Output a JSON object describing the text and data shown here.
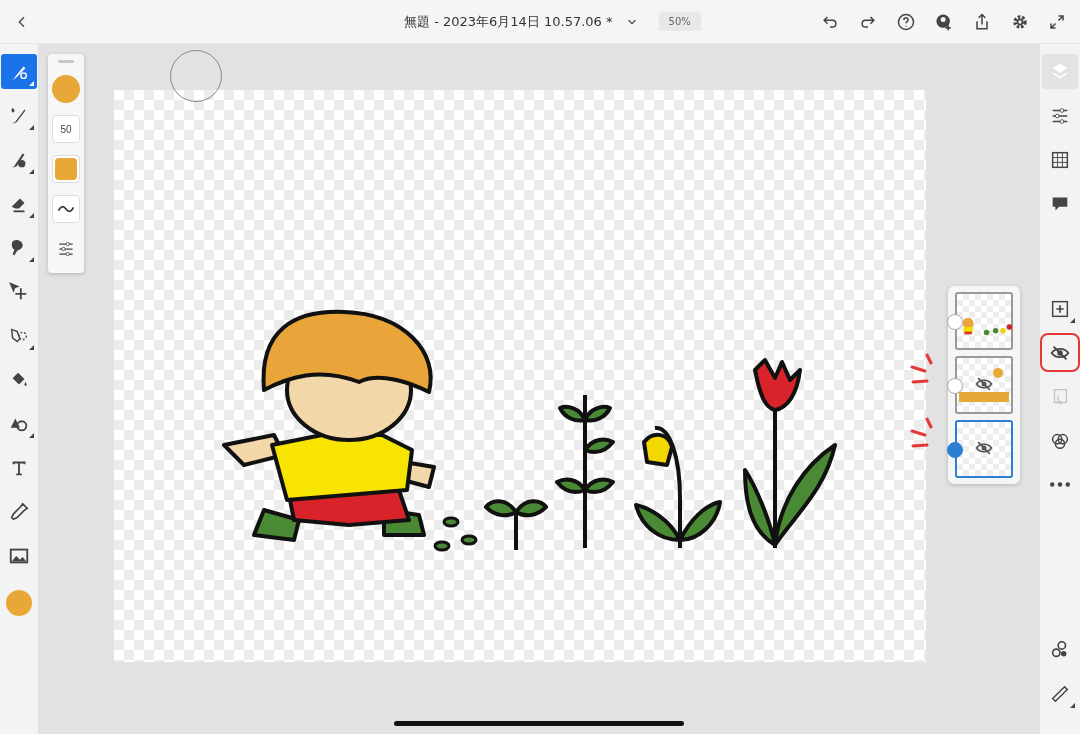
{
  "header": {
    "title": "無題 - 2023年6月14日 10.57.06 *",
    "zoom": "50%"
  },
  "left_tools": [
    {
      "selected": true,
      "submenu": true
    },
    {
      "selected": false,
      "submenu": true
    },
    {
      "selected": false,
      "submenu": true
    },
    {
      "selected": false,
      "submenu": true
    },
    {
      "selected": false,
      "submenu": true
    },
    {
      "selected": false,
      "submenu": false
    },
    {
      "selected": false,
      "submenu": true
    },
    {
      "selected": false,
      "submenu": false
    },
    {
      "selected": false,
      "submenu": true
    },
    {
      "selected": false,
      "submenu": false
    },
    {
      "selected": false,
      "submenu": false
    },
    {
      "selected": false,
      "submenu": false
    }
  ],
  "current_color": {
    "color": "#e8a838"
  },
  "brush_panel": {
    "color": "#e8a838",
    "size": "50"
  },
  "right_tools": [
    {
      "selected": true,
      "disabled": false,
      "highlighted": false,
      "submenu": false
    },
    {
      "selected": false,
      "disabled": false,
      "highlighted": false,
      "submenu": false
    },
    {
      "selected": false,
      "disabled": false,
      "highlighted": false,
      "submenu": false
    },
    {
      "selected": false,
      "disabled": false,
      "highlighted": false,
      "submenu": false
    },
    {
      "selected": false,
      "disabled": false,
      "highlighted": false,
      "submenu": true
    },
    {
      "selected": false,
      "disabled": false,
      "highlighted": true,
      "submenu": false
    },
    {
      "selected": false,
      "disabled": true,
      "highlighted": false,
      "submenu": false
    },
    {
      "selected": false,
      "disabled": false,
      "highlighted": false,
      "submenu": false
    },
    {
      "selected": false,
      "disabled": false,
      "highlighted": false,
      "submenu": false
    }
  ],
  "right_bottom_tools": [
    {
      "submenu": false
    },
    {
      "submenu": true
    }
  ],
  "layers": [
    {
      "kind": "artwork",
      "hidden": false,
      "selected": false,
      "annotated": false
    },
    {
      "kind": "sun",
      "hidden": true,
      "selected": false,
      "annotated": true
    },
    {
      "kind": "image",
      "hidden": true,
      "selected": true,
      "annotated": true
    }
  ]
}
